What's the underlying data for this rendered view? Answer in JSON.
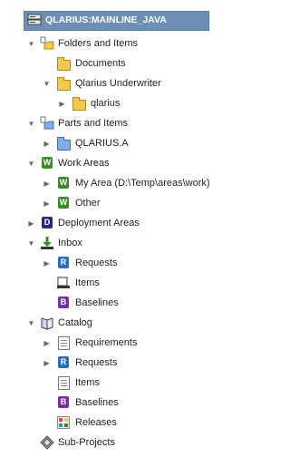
{
  "root": {
    "label": "QLARIUS:MAINLINE_JAVA"
  },
  "tree": {
    "folders_and_items": {
      "label": "Folders and Items",
      "children": {
        "documents": "Documents",
        "qlarius_underwriter": "Qlarius Underwriter",
        "qlarius": "qlarius"
      }
    },
    "parts_and_items": {
      "label": "Parts and Items",
      "children": {
        "qlarius_a": "QLARIUS.A"
      }
    },
    "work_areas": {
      "label": "Work Areas",
      "children": {
        "my_area": "My Area (D:\\Temp\\areas\\work)",
        "other": "Other"
      }
    },
    "deployment_areas": {
      "label": "Deployment Areas"
    },
    "inbox": {
      "label": "Inbox",
      "children": {
        "requests": "Requests",
        "items": "Items",
        "baselines": "Baselines"
      }
    },
    "catalog": {
      "label": "Catalog",
      "children": {
        "requirements": "Requirements",
        "requests": "Requests",
        "items": "Items",
        "baselines": "Baselines",
        "releases": "Releases"
      }
    },
    "sub_projects": {
      "label": "Sub-Projects"
    }
  },
  "icons": {
    "root": "server-icon",
    "folders_and_items": "folders-icon",
    "folder": "folder-icon",
    "parts_and_items": "parts-icon",
    "part": "part-folder-icon",
    "work_areas": "work-area-icon",
    "deployment_areas": "deployment-icon",
    "inbox": "inbox-icon",
    "requests": "request-icon",
    "items": "item-icon",
    "baselines": "baseline-icon",
    "catalog": "catalog-icon",
    "requirements": "requirements-icon",
    "releases": "releases-icon",
    "sub_projects": "sub-projects-icon"
  },
  "colors": {
    "selection": "#6d8fb5",
    "folder": "#f2c94c",
    "part_folder": "#7fb0e8",
    "work_area": "#3d8a2a",
    "request": "#2a6dbf",
    "baseline": "#7b2fa0",
    "deployment": "#2a2a7a"
  }
}
